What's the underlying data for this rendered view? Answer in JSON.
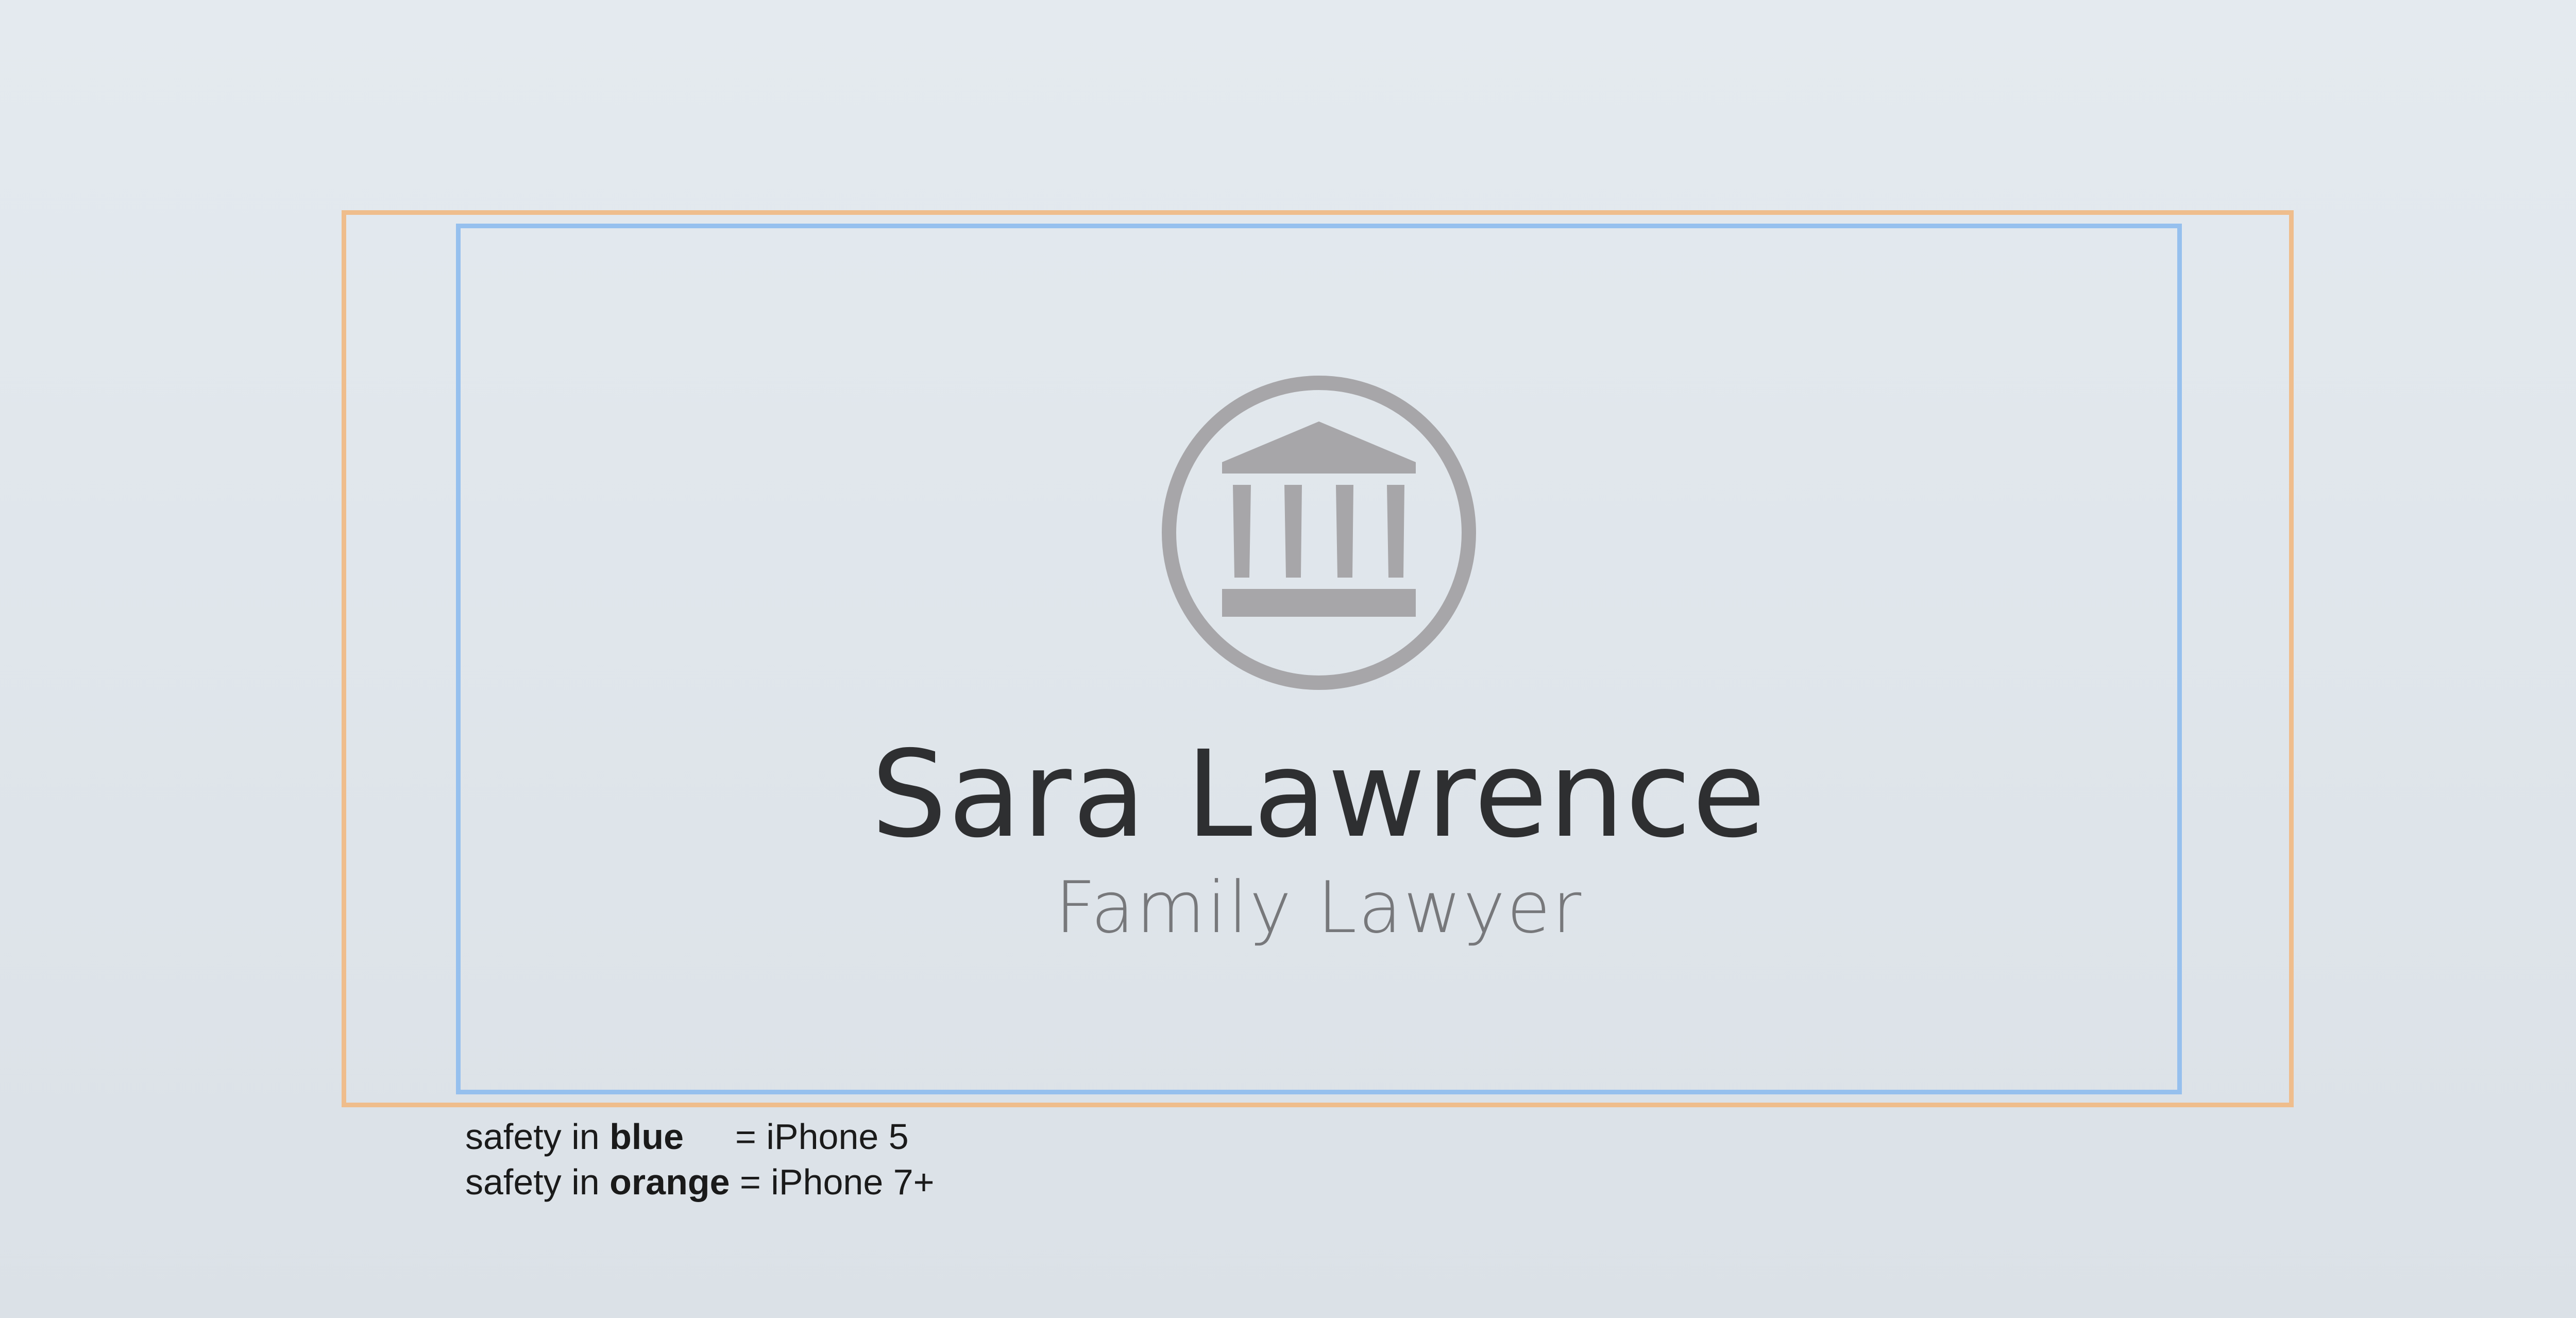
{
  "card": {
    "name": "Sara Lawrence",
    "title": "Family Lawyer",
    "logo_icon": "courthouse-icon",
    "icon_color": "#a7a6a9"
  },
  "legend": {
    "line1": {
      "prefix": "safety in ",
      "keyword": "blue",
      "suffix": "= iPhone 5"
    },
    "line2": {
      "prefix": "safety in ",
      "keyword": "orange",
      "suffix": " = iPhone 7+"
    }
  },
  "colors": {
    "blue_safety": "#96c0ee",
    "orange_safety": "#efbd8c",
    "name_text": "#2e2f31",
    "title_text": "#77787b"
  }
}
